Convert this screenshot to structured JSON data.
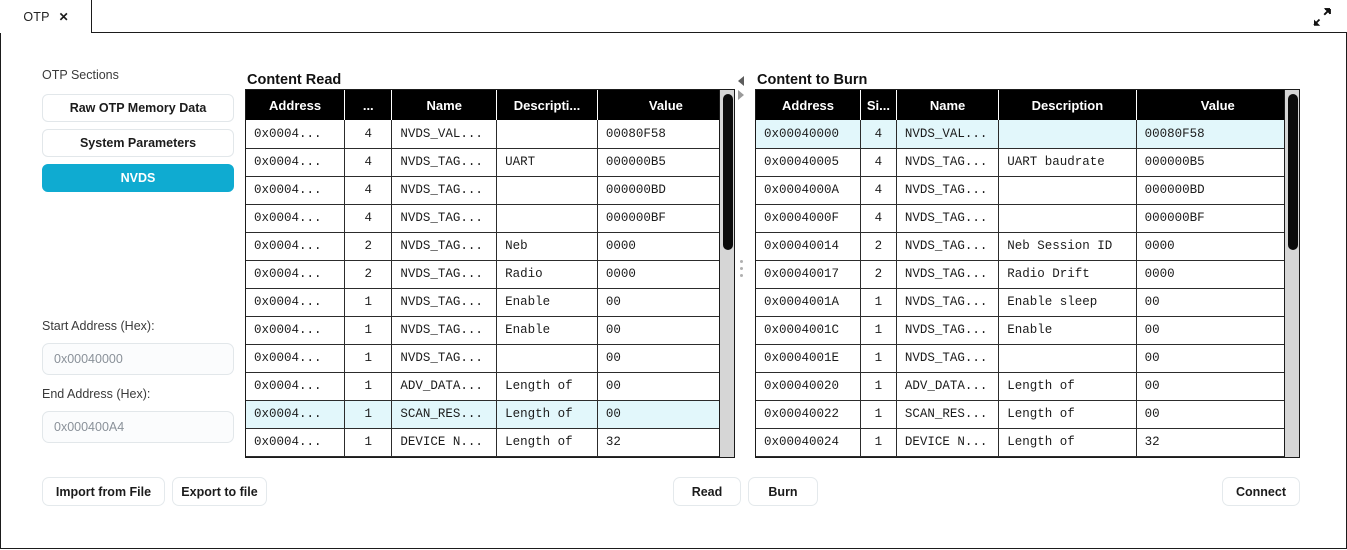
{
  "window": {
    "tab_label": "OTP",
    "tab_close_icon": "close-icon",
    "expand_icon": "expand-diagonal-icon"
  },
  "sidebar": {
    "heading": "OTP Sections",
    "items": [
      {
        "label": "Raw OTP Memory Data",
        "active": false
      },
      {
        "label": "System Parameters",
        "active": false
      },
      {
        "label": "NVDS",
        "active": true
      }
    ],
    "start_address": {
      "label": "Start Address (Hex):",
      "value": "0x00040000",
      "placeholder": "0x00040000"
    },
    "end_address": {
      "label": "End Address (Hex):",
      "value": "0x000400A4",
      "placeholder": "0x000400A4"
    },
    "import_button": "Import from File",
    "export_button": "Export to file"
  },
  "content_read": {
    "title": "Content Read",
    "columns": [
      "Address",
      "...",
      "Name",
      "Descripti...",
      "Value"
    ],
    "rows": [
      {
        "address": "0x0004...",
        "size": "4",
        "name": "NVDS_VAL...",
        "description": "",
        "value": "00080F58",
        "selected": false
      },
      {
        "address": "0x0004...",
        "size": "4",
        "name": "NVDS_TAG...",
        "description": "UART",
        "value": "000000B5",
        "selected": false
      },
      {
        "address": "0x0004...",
        "size": "4",
        "name": "NVDS_TAG...",
        "description": "",
        "value": "000000BD",
        "selected": false
      },
      {
        "address": "0x0004...",
        "size": "4",
        "name": "NVDS_TAG...",
        "description": "",
        "value": "000000BF",
        "selected": false
      },
      {
        "address": "0x0004...",
        "size": "2",
        "name": "NVDS_TAG...",
        "description": "Neb",
        "value": "0000",
        "selected": false
      },
      {
        "address": "0x0004...",
        "size": "2",
        "name": "NVDS_TAG...",
        "description": "Radio",
        "value": "0000",
        "selected": false
      },
      {
        "address": "0x0004...",
        "size": "1",
        "name": "NVDS_TAG...",
        "description": "Enable",
        "value": "00",
        "selected": false
      },
      {
        "address": "0x0004...",
        "size": "1",
        "name": "NVDS_TAG...",
        "description": "Enable",
        "value": "00",
        "selected": false
      },
      {
        "address": "0x0004...",
        "size": "1",
        "name": "NVDS_TAG...",
        "description": "",
        "value": "00",
        "selected": false
      },
      {
        "address": "0x0004...",
        "size": "1",
        "name": "ADV_DATA...",
        "description": "Length of",
        "value": "00",
        "selected": false
      },
      {
        "address": "0x0004...",
        "size": "1",
        "name": "SCAN_RES...",
        "description": "Length of",
        "value": "00",
        "selected": true
      },
      {
        "address": "0x0004...",
        "size": "1",
        "name": "DEVICE N...",
        "description": "Length of",
        "value": "32",
        "selected": false
      }
    ]
  },
  "content_burn": {
    "title": "Content to Burn",
    "columns": [
      "Address",
      "Si...",
      "Name",
      "Description",
      "Value"
    ],
    "rows": [
      {
        "address": "0x00040000",
        "size": "4",
        "name": "NVDS_VAL...",
        "description": "",
        "value": "00080F58",
        "selected": true
      },
      {
        "address": "0x00040005",
        "size": "4",
        "name": "NVDS_TAG...",
        "description": "UART baudrate",
        "value": "000000B5",
        "selected": false
      },
      {
        "address": "0x0004000A",
        "size": "4",
        "name": "NVDS_TAG...",
        "description": "",
        "value": "000000BD",
        "selected": false
      },
      {
        "address": "0x0004000F",
        "size": "4",
        "name": "NVDS_TAG...",
        "description": "",
        "value": "000000BF",
        "selected": false
      },
      {
        "address": "0x00040014",
        "size": "2",
        "name": "NVDS_TAG...",
        "description": "Neb Session ID",
        "value": "0000",
        "selected": false
      },
      {
        "address": "0x00040017",
        "size": "2",
        "name": "NVDS_TAG...",
        "description": "Radio Drift",
        "value": "0000",
        "selected": false
      },
      {
        "address": "0x0004001A",
        "size": "1",
        "name": "NVDS_TAG...",
        "description": "Enable sleep",
        "value": "00",
        "selected": false
      },
      {
        "address": "0x0004001C",
        "size": "1",
        "name": "NVDS_TAG...",
        "description": "Enable",
        "value": "00",
        "selected": false
      },
      {
        "address": "0x0004001E",
        "size": "1",
        "name": "NVDS_TAG...",
        "description": "",
        "value": "00",
        "selected": false
      },
      {
        "address": "0x00040020",
        "size": "1",
        "name": "ADV_DATA...",
        "description": "Length of",
        "value": "00",
        "selected": false
      },
      {
        "address": "0x00040022",
        "size": "1",
        "name": "SCAN_RES...",
        "description": "Length of",
        "value": "00",
        "selected": false
      },
      {
        "address": "0x00040024",
        "size": "1",
        "name": "DEVICE N...",
        "description": "Length of",
        "value": "32",
        "selected": false
      }
    ]
  },
  "actions": {
    "read_button": "Read",
    "burn_button": "Burn",
    "connect_button": "Connect"
  },
  "colors": {
    "accent": "#0fabd1",
    "selection": "#e2f7fb",
    "header_bg": "#000000",
    "border": "#1b1b1b"
  }
}
